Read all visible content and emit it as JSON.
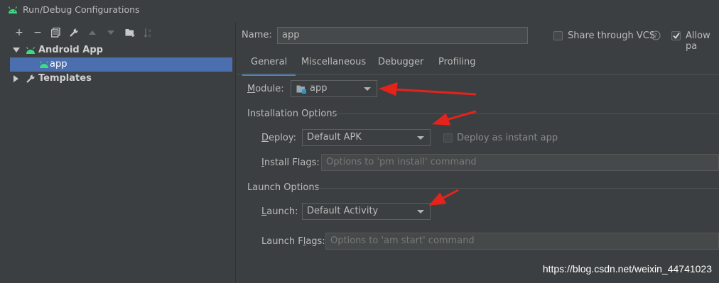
{
  "window": {
    "title": "Run/Debug Configurations"
  },
  "toolbar": {
    "icons": [
      "plus-icon",
      "minus-icon",
      "copy-icon",
      "wrench-icon",
      "arrow-up-icon",
      "arrow-down-icon",
      "new-folder-icon",
      "sort-icon"
    ]
  },
  "tree": {
    "android_app": "Android App",
    "app": "app",
    "templates": "Templates"
  },
  "name": {
    "label": "Name:",
    "value": "app"
  },
  "share": {
    "label": "Share through VCS",
    "checked": false
  },
  "allow": {
    "label": "Allow pa",
    "checked": true
  },
  "tabs": [
    {
      "label": "General",
      "active": true
    },
    {
      "label": "Miscellaneous",
      "active": false
    },
    {
      "label": "Debugger",
      "active": false
    },
    {
      "label": "Profiling",
      "active": false
    }
  ],
  "module": {
    "label": "Module:",
    "value": "app"
  },
  "installation": {
    "section": "Installation Options",
    "deploy_label": "Deploy:",
    "deploy_value": "Default APK",
    "instant_label": "Deploy as instant app",
    "flags_label": "Install Flags:",
    "flags_placeholder": "Options to 'pm install' command"
  },
  "launch": {
    "section": "Launch Options",
    "launch_label": "Launch:",
    "launch_value": "Default Activity",
    "flags_label": "Launch Flags:",
    "flags_placeholder": "Options to 'am start' command"
  },
  "watermark": "https://blog.csdn.net/weixin_44741023",
  "colors": {
    "accent": "#4a88c7",
    "selection": "#4b6eaf",
    "android": "#3ddc84",
    "annotation": "#e5231b"
  }
}
